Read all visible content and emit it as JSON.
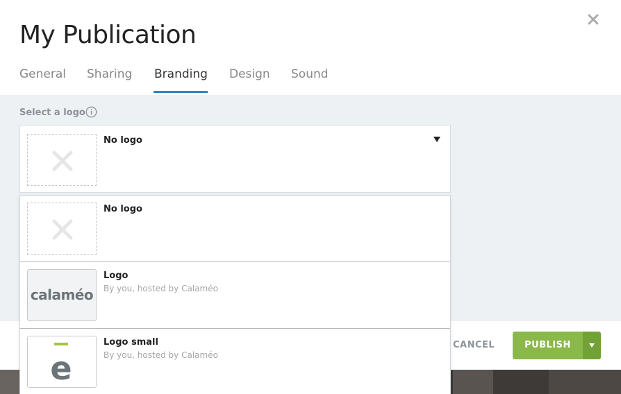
{
  "modal": {
    "title": "My Publication",
    "close_icon": "close-icon"
  },
  "tabs": [
    {
      "label": "General",
      "active": false
    },
    {
      "label": "Sharing",
      "active": false
    },
    {
      "label": "Branding",
      "active": true
    },
    {
      "label": "Design",
      "active": false
    },
    {
      "label": "Sound",
      "active": false
    }
  ],
  "branding": {
    "select_label": "Select a logo",
    "info_icon": "info-icon",
    "selected": {
      "name": "No logo"
    },
    "options": [
      {
        "name": "No logo",
        "subtitle": "",
        "thumb": "no-logo"
      },
      {
        "name": "Logo",
        "subtitle": "By you, hosted by Calaméo",
        "thumb": "calameo-logo",
        "thumb_text": "calaméo"
      },
      {
        "name": "Logo small",
        "subtitle": "By you, hosted by Calaméo",
        "thumb": "calameo-small-logo"
      }
    ]
  },
  "footer": {
    "cancel_label": "CANCEL",
    "publish_label": "PUBLISH"
  },
  "colors": {
    "accent_tab": "#2f86c4",
    "publish_green": "#8ab84a",
    "publish_green_dark": "#72a138",
    "logo_lime": "#a8c43a",
    "logo_gray": "#6b7478"
  }
}
